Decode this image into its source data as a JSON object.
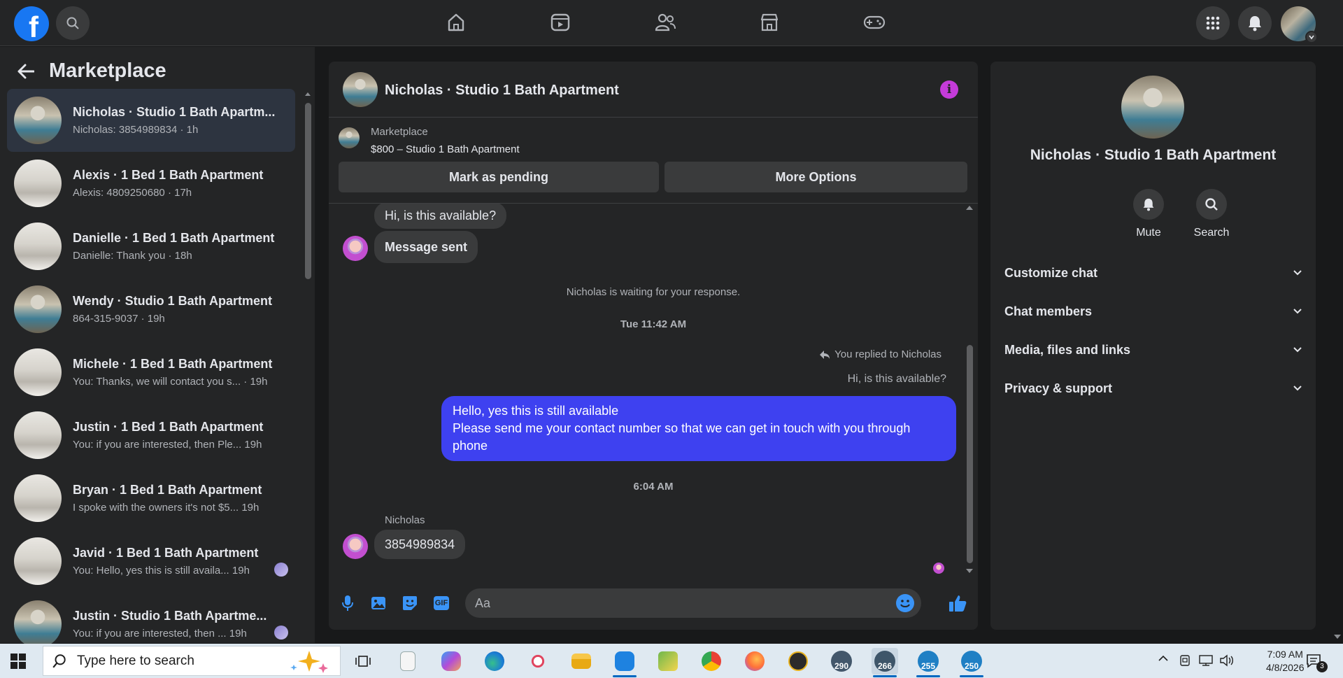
{
  "sidebar": {
    "title": "Marketplace",
    "conversations": [
      {
        "title": "Nicholas · Studio 1 Bath Apartm...",
        "preview": "Nicholas: 3854989834 · 1h",
        "thumb": "studio",
        "active": true
      },
      {
        "title": "Alexis · 1 Bed 1 Bath Apartment",
        "preview": "Alexis: 4809250680 · 17h",
        "thumb": "bed"
      },
      {
        "title": "Danielle · 1 Bed 1 Bath Apartment",
        "preview": "Danielle: Thank you · 18h",
        "thumb": "bed"
      },
      {
        "title": "Wendy · Studio 1 Bath Apartment",
        "preview": "864-315-9037 · 19h",
        "thumb": "studio"
      },
      {
        "title": "Michele · 1 Bed 1 Bath Apartment",
        "preview": "You: Thanks, we will contact you s... · 19h",
        "thumb": "bed"
      },
      {
        "title": "Justin · 1 Bed 1 Bath Apartment",
        "preview": "You: if you are interested, then Ple... 19h",
        "thumb": "bed"
      },
      {
        "title": "Bryan · 1 Bed 1 Bath Apartment",
        "preview": "I spoke with the owners it's not $5... 19h",
        "thumb": "bed"
      },
      {
        "title": "Javid · 1 Bed 1 Bath Apartment",
        "preview": "You: Hello, yes this is still availa... 19h",
        "thumb": "bed",
        "seen": true
      },
      {
        "title": "Justin · Studio 1 Bath Apartme...",
        "preview": "You: if you are interested, then ... 19h",
        "thumb": "studio",
        "seen": true
      }
    ]
  },
  "chat": {
    "title": "Nicholas · Studio 1 Bath Apartment",
    "marketplace_label": "Marketplace",
    "listing": "$800 – Studio 1 Bath Apartment",
    "mark_pending": "Mark as pending",
    "more_options": "More Options",
    "msg1": "Hi, is this available?",
    "msg2": "Message sent",
    "waiting": "Nicholas is waiting for your response.",
    "time1": "Tue 11:42 AM",
    "replied_to": "You replied to Nicholas",
    "quoted": "Hi, is this available?",
    "reply_line1": "Hello, yes this is still available",
    "reply_line2": "Please send me your contact number so that we can get in touch with you through phone",
    "time2": "6:04 AM",
    "sender": "Nicholas",
    "last_msg": "3854989834",
    "placeholder": "Aa"
  },
  "details": {
    "name": "Nicholas · Studio 1 Bath Apartment",
    "mute": "Mute",
    "search": "Search",
    "sections": [
      "Customize chat",
      "Chat members",
      "Media, files and links",
      "Privacy & support"
    ]
  },
  "taskbar": {
    "search_placeholder": "Type here to search",
    "time": "7:09 AM",
    "date": "4/8/2026",
    "notification_count": "3",
    "badges": [
      "290",
      "266",
      "255",
      "250"
    ]
  },
  "colors": {
    "accent": "#1877f2",
    "outgoing_bubble": "#3e41f0",
    "info": "#c43bd9"
  }
}
